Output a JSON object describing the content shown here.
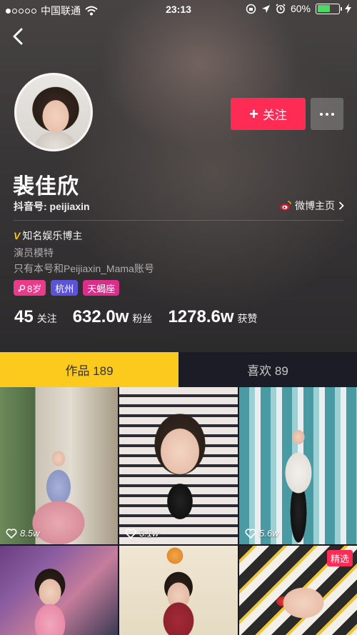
{
  "status_bar": {
    "carrier": "中国联通",
    "time": "23:13",
    "battery": "60%",
    "battery_level": 0.6
  },
  "profile": {
    "name": "裴佳欣",
    "douyin_id": "抖音号: peijiaxin",
    "weibo_link": "微博主页",
    "follow_button": "关注",
    "verification": "知名娱乐博主",
    "bio_line1": "演员模特",
    "bio_line2": "只有本号和Peijiaxin_Mama账号",
    "tags": {
      "age": "8岁",
      "city": "杭州",
      "zodiac": "天蝎座"
    }
  },
  "stats": {
    "following_count": "45",
    "following_label": "关注",
    "followers_count": "632.0w",
    "followers_label": "粉丝",
    "likes_count": "1278.6w",
    "likes_label": "获赞"
  },
  "tabs": {
    "works": "作品 189",
    "liked": "喜欢 89"
  },
  "videos": [
    {
      "likes": "8.5w"
    },
    {
      "likes": "3.1w"
    },
    {
      "likes": "5.6w"
    },
    {
      "likes": ""
    },
    {
      "likes": ""
    },
    {
      "likes": "",
      "badge": "精选"
    }
  ],
  "colors": {
    "accent": "#fe2c55",
    "tab_active": "#fcc91d",
    "tab_inactive": "#1b1c26",
    "verified": "#f5c518",
    "tag_age": "#ec3a8a",
    "tag_city": "#5b54d9",
    "tag_zodiac": "#d92f8b"
  },
  "icons": {
    "back": "chevron-left-icon",
    "more": "more-dots-icon",
    "weibo": "weibo-icon",
    "verified": "verified-v-icon",
    "heart": "heart-icon",
    "age": "female-icon",
    "wifi": "wifi-icon",
    "location": "location-icon",
    "alarm": "alarm-icon",
    "charging": "charging-icon"
  }
}
